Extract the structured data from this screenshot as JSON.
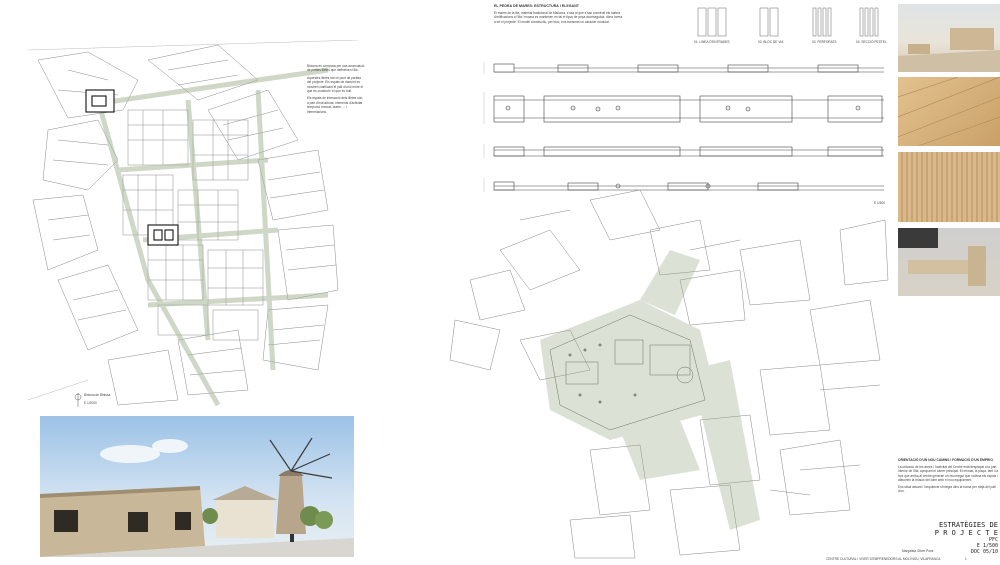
{
  "left_plan": {
    "notes": [
      "Biniona és composa per una acumulació de petites illetes que defineixen l'illa.",
      "Aquestes illetes són el punt de partida del projecte. Els espais de damunt es mostren clarificant el pati d'unió entre el que és construït i el que és buit.",
      "Els espais de interacció dels illetes són, a part d'estructurar, elements d'activitat temporal: mercat, teatre, ... i interrelacions."
    ],
    "scale_label": "Biniona de Binissa",
    "scale_value": "E 1/2000"
  },
  "section_panel": {
    "heading": "EL PEDRA DE MARES: ESTRUCTURA I ELEGANT",
    "paragraph": "El mares de la illa, material tradicional de Mallorca, s'usa al que s'han construit els mateix d'edificacions a l'illa i encara es mantenen en tal el tipus de peça aconseguida, dóna forma a tot el projecte. El model constructiu, per bloc, ens transmet un caràcter modular.",
    "block_labels": [
      "01. LINEA D'ENTRADES",
      "02. BLOC DE VIA",
      "03. PERFORATS",
      "04. SECCIÓ PESTEL"
    ],
    "scale": "E 1/500"
  },
  "right_text": {
    "heading": "ORIENTACIÓ D'UN NOU CAMINS I FORMACIÓ D'UN EMPRIO",
    "paragraph": "La ubicació de les àrees i l'activitat del Centre està desplaçat a la part interior de l'illa, apropant el carrer principal. El mercat, la plaça, tant i la font que arriba al centre generen un recorregut que ordena els espais i afavoreix la relació del barri amb el nou equipament.",
    "paragraph2": "Ens situa davant i l'arquitecte s'integra dins la trama per mitjà del pati d'un."
  },
  "title_block": {
    "line1": "ESTRATÈGIES DE",
    "line2": "P R O J E C T E",
    "line3": "PFC",
    "line4": "E 1/500",
    "line5": "DOC 05/10",
    "author": "Margalida Oliver Pons",
    "footer": "CENTRE CULTURAL I VIVER D'EMPRENEDORS AL MOLÍ NOU, VILAFRANCA",
    "page": "1"
  },
  "colors": {
    "paper": "#ffffff",
    "line": "#555555",
    "green": "#9aaa86",
    "sky": "#b9d4ec",
    "stone": "#c9b79a"
  }
}
